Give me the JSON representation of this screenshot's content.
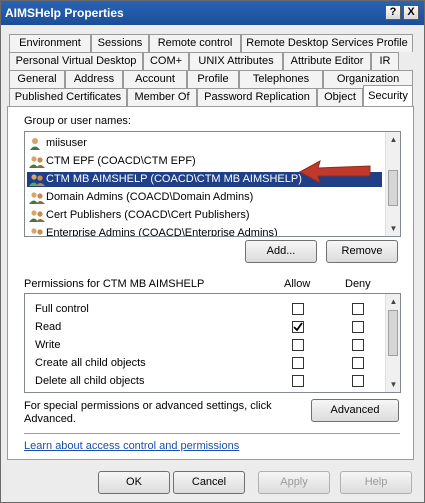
{
  "window": {
    "title": "AIMSHelp Properties",
    "help_glyph": "?",
    "close_glyph": "X"
  },
  "tabs": {
    "row1": [
      "Environment",
      "Sessions",
      "Remote control",
      "Remote Desktop Services Profile"
    ],
    "row2": [
      "Personal Virtual Desktop",
      "COM+",
      "UNIX Attributes",
      "Attribute Editor",
      "IR"
    ],
    "row3": [
      "General",
      "Address",
      "Account",
      "Profile",
      "Telephones",
      "Organization"
    ],
    "row4": [
      "Published Certificates",
      "Member Of",
      "Password Replication",
      "Object",
      "Security"
    ],
    "active": "Security"
  },
  "security": {
    "group_label": "Group or user names:",
    "users": [
      {
        "name": "miisuser",
        "icon": "user-icon"
      },
      {
        "name": "CTM EPF (COACD\\CTM EPF)",
        "icon": "group-icon"
      },
      {
        "name": "CTM MB AIMSHELP (COACD\\CTM MB AIMSHELP)",
        "icon": "group-icon",
        "selected": true
      },
      {
        "name": "Domain Admins (COACD\\Domain Admins)",
        "icon": "group-icon"
      },
      {
        "name": "Cert Publishers (COACD\\Cert Publishers)",
        "icon": "group-icon"
      },
      {
        "name": "Enterprise Admins (COACD\\Enterprise Admins)",
        "icon": "group-icon"
      }
    ],
    "add_label": "Add...",
    "remove_label": "Remove",
    "permissions_label": "Permissions for CTM MB AIMSHELP",
    "allow_label": "Allow",
    "deny_label": "Deny",
    "permissions": [
      {
        "name": "Full control",
        "allow": false,
        "deny": false
      },
      {
        "name": "Read",
        "allow": true,
        "deny": false
      },
      {
        "name": "Write",
        "allow": false,
        "deny": false
      },
      {
        "name": "Create all child objects",
        "allow": false,
        "deny": false
      },
      {
        "name": "Delete all child objects",
        "allow": false,
        "deny": false
      }
    ],
    "special_text_line1": "For special permissions or advanced settings, click",
    "special_text_line2": "Advanced.",
    "advanced_label": "Advanced",
    "learn_link": "Learn about access control and permissions",
    "annotation_arrow_color": "#c0392b"
  },
  "footer": {
    "ok_label": "OK",
    "cancel_label": "Cancel",
    "apply_label": "Apply",
    "help_label": "Help"
  }
}
